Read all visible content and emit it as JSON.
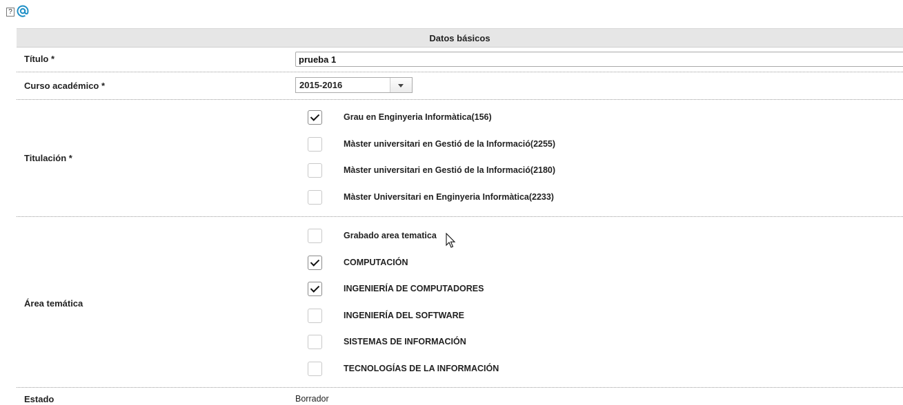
{
  "header": {
    "title": "Datos básicos"
  },
  "form": {
    "titulo": {
      "label": "Título *",
      "value": "prueba 1"
    },
    "curso": {
      "label": "Curso académico *",
      "value": "2015-2016"
    },
    "titulacion": {
      "label": "Titulación *",
      "options": [
        {
          "label": "Grau en Enginyeria Informàtica(156)",
          "checked": true
        },
        {
          "label": "Màster universitari en Gestió de la Informació(2255)",
          "checked": false
        },
        {
          "label": "Màster universitari en Gestió de la Informació(2180)",
          "checked": false
        },
        {
          "label": "Màster Universitari en Enginyeria Informàtica(2233)",
          "checked": false
        }
      ]
    },
    "area": {
      "label": "Área temática",
      "options": [
        {
          "label": "Grabado area tematica",
          "checked": false
        },
        {
          "label": "COMPUTACIÓN",
          "checked": true
        },
        {
          "label": "INGENIERÍA DE COMPUTADORES",
          "checked": true
        },
        {
          "label": "INGENIERÍA DEL SOFTWARE",
          "checked": false
        },
        {
          "label": "SISTEMAS DE INFORMACIÓN",
          "checked": false
        },
        {
          "label": "TECNOLOGÍAS DE LA INFORMACIÓN",
          "checked": false
        }
      ]
    },
    "estado": {
      "label": "Estado",
      "value": "Borrador"
    }
  },
  "icons": {
    "help": "help-icon",
    "email": "at-sign-icon"
  },
  "colors": {
    "header_bg": "#e6e6e6",
    "link_blue": "#1e8fc6"
  }
}
